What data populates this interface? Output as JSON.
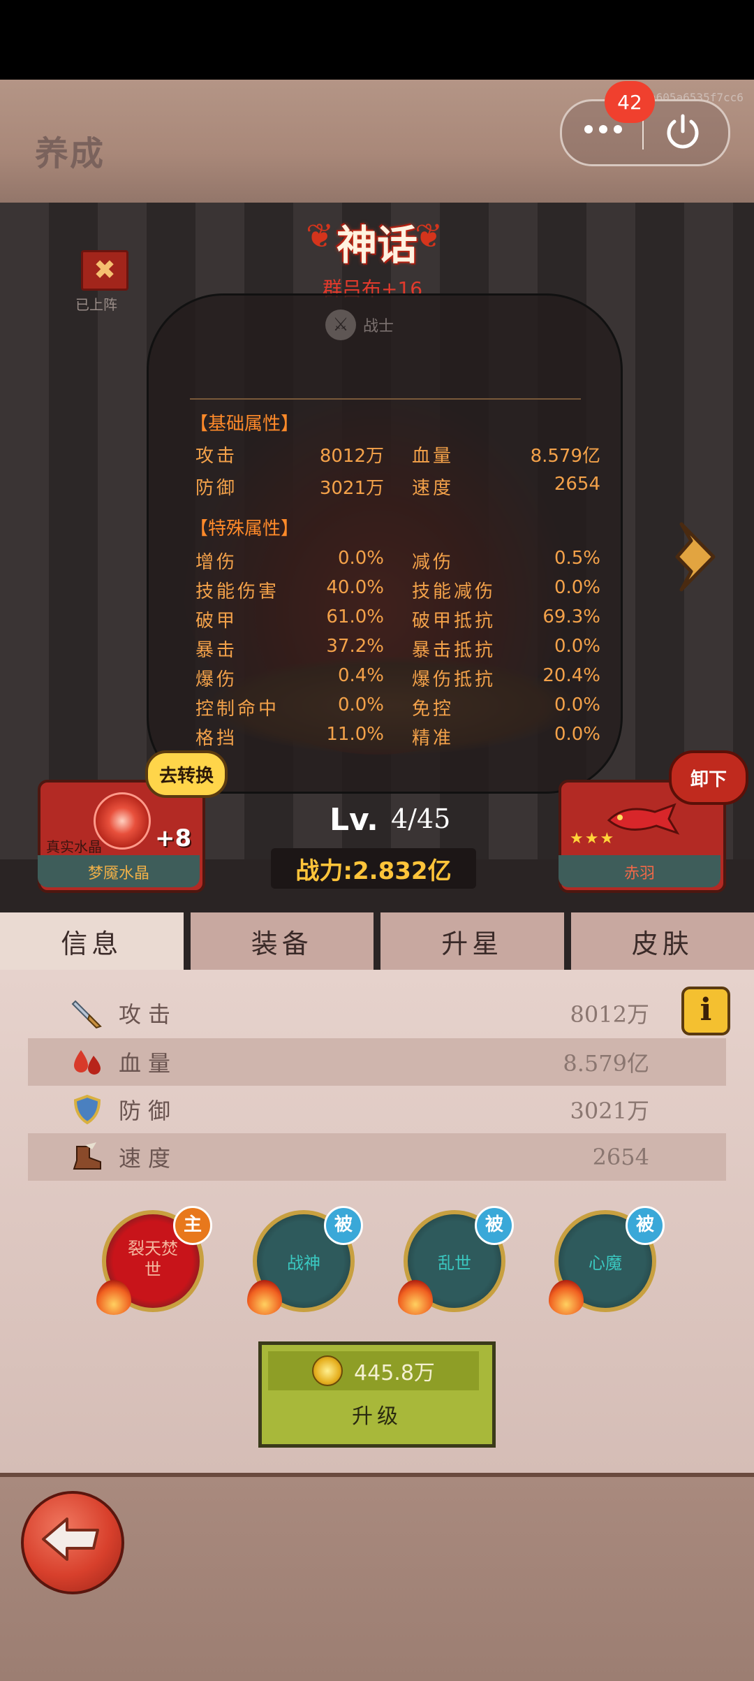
{
  "header": {
    "title": "养成",
    "notification_count": "42",
    "session_hash": "a605a6535f7cc6"
  },
  "deploy": {
    "label": "已上阵"
  },
  "hero": {
    "rarity": "神话",
    "name": "群吕布+16",
    "class": "战士",
    "level_prefix": "Lv.",
    "level": "4/45",
    "power": "战力:2.832亿"
  },
  "stats_overlay": {
    "basic_title": "【基础属性】",
    "basic": [
      {
        "l1": "攻击",
        "v1": "8012万",
        "l2": "血量",
        "v2": "8.579亿"
      },
      {
        "l1": "防御",
        "v1": "3021万",
        "l2": "速度",
        "v2": "2654"
      }
    ],
    "special_title": "【特殊属性】",
    "special": [
      {
        "l1": "增伤",
        "v1": "0.0%",
        "l2": "减伤",
        "v2": "0.5%"
      },
      {
        "l1": "技能伤害",
        "v1": "40.0%",
        "l2": "技能减伤",
        "v2": "0.0%"
      },
      {
        "l1": "破甲",
        "v1": "61.0%",
        "l2": "破甲抵抗",
        "v2": "69.3%"
      },
      {
        "l1": "暴击",
        "v1": "37.2%",
        "l2": "暴击抵抗",
        "v2": "0.0%"
      },
      {
        "l1": "爆伤",
        "v1": "0.4%",
        "l2": "爆伤抵抗",
        "v2": "20.4%"
      },
      {
        "l1": "控制命中",
        "v1": "0.0%",
        "l2": "免控",
        "v2": "0.0%"
      },
      {
        "l1": "格挡",
        "v1": "11.0%",
        "l2": "精准",
        "v2": "0.0%"
      }
    ]
  },
  "crystal": {
    "swap_label": "去转换",
    "plus": "+8",
    "sub": "真实水晶",
    "name": "梦魇水晶"
  },
  "pet": {
    "unequip_label": "卸下",
    "stars": "★★★",
    "name": "赤羽"
  },
  "tabs": [
    "信息",
    "装备",
    "升星",
    "皮肤"
  ],
  "info": {
    "stats": [
      {
        "icon": "sword-icon",
        "label": "攻击",
        "value": "8012万"
      },
      {
        "icon": "blood-icon",
        "label": "血量",
        "value": "8.579亿"
      },
      {
        "icon": "shield-icon",
        "label": "防御",
        "value": "3021万"
      },
      {
        "icon": "boot-icon",
        "label": "速度",
        "value": "2654"
      }
    ],
    "info_glyph": "i"
  },
  "skills": [
    {
      "name": "裂天焚世",
      "tag": "主",
      "color": "#c8141a",
      "tag_color": "#e8781c"
    },
    {
      "name": "战神",
      "tag": "被",
      "color": "#2e5a5c",
      "tag_color": "#3aa8d8"
    },
    {
      "name": "乱世",
      "tag": "被",
      "color": "#2e5a5c",
      "tag_color": "#3aa8d8"
    },
    {
      "name": "心魔",
      "tag": "被",
      "color": "#2e5a5c",
      "tag_color": "#3aa8d8"
    }
  ],
  "upgrade": {
    "cost": "445.8万",
    "label": "升级"
  }
}
